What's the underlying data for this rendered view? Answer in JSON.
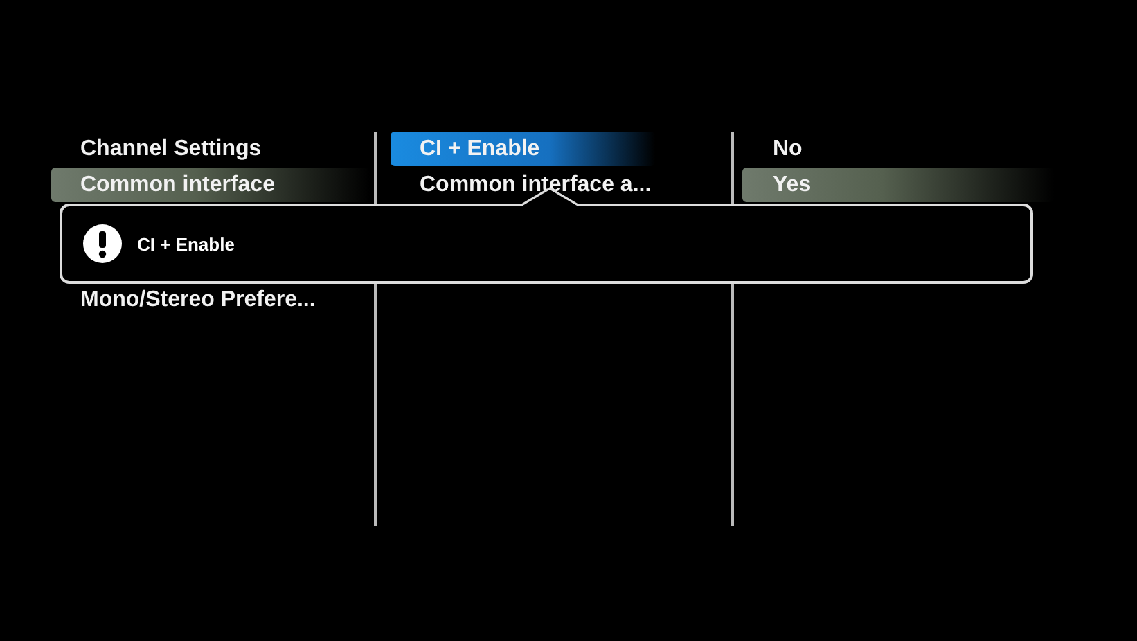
{
  "columns": [
    {
      "items": [
        {
          "label": "Channel Settings",
          "selected": false
        },
        {
          "label": "Common interface",
          "selected": true
        },
        {
          "label": "Mono/Stereo Prefere...",
          "selected": false
        }
      ]
    },
    {
      "items": [
        {
          "label": "CI + Enable",
          "selected": true
        },
        {
          "label": "Common interface a...",
          "selected": false
        }
      ]
    },
    {
      "items": [
        {
          "label": "No",
          "selected": false
        },
        {
          "label": "Yes",
          "selected": true
        }
      ]
    }
  ],
  "tooltip": {
    "text": "CI + Enable"
  }
}
